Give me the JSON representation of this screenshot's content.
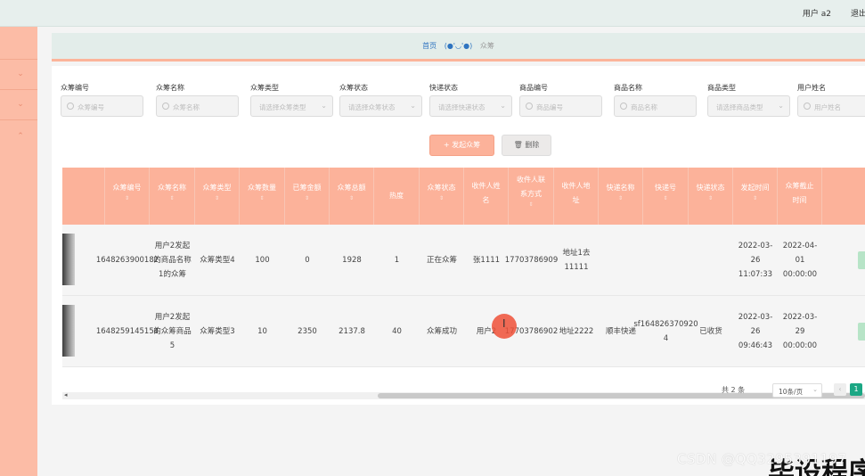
{
  "topbar": {
    "user_label": "用户 a2",
    "logout_label": "退出"
  },
  "breadcrumb": {
    "home": "首页",
    "face": "(●'◡'●)",
    "current": "众筹"
  },
  "filters": [
    {
      "label": "众筹编号",
      "placeholder": "众筹编号",
      "type": "input"
    },
    {
      "label": "众筹名称",
      "placeholder": "众筹名称",
      "type": "input"
    },
    {
      "label": "众筹类型",
      "placeholder": "请选择众筹类型",
      "type": "select"
    },
    {
      "label": "众筹状态",
      "placeholder": "请选择众筹状态",
      "type": "select"
    },
    {
      "label": "快递状态",
      "placeholder": "请选择快递状态",
      "type": "select"
    },
    {
      "label": "商品编号",
      "placeholder": "商品编号",
      "type": "input"
    },
    {
      "label": "商品名称",
      "placeholder": "商品名称",
      "type": "input"
    },
    {
      "label": "商品类型",
      "placeholder": "请选择商品类型",
      "type": "select"
    },
    {
      "label": "用户姓名",
      "placeholder": "用户姓名",
      "type": "input"
    }
  ],
  "buttons": {
    "add": "+ 发起众筹",
    "delete": "🗑 删除"
  },
  "table": {
    "columns": [
      "众筹编号",
      "众筹名称",
      "众筹类型",
      "众筹数量",
      "已筹金额",
      "众筹总额",
      "热度",
      "众筹状态",
      "收件人姓名",
      "收件人联系方式",
      "收件人地址",
      "快递名称",
      "快递号",
      "快递状态",
      "发起时间",
      "众筹截止时间"
    ],
    "rows": [
      [
        "1648263900182",
        "用户2发起的商品名称1的众筹",
        "众筹类型4",
        "100",
        "0",
        "1928",
        "1",
        "正在众筹",
        "张1111",
        "17703786909",
        "地址1去11111",
        "",
        "",
        "",
        "2022-03-26 11:07:33",
        "2022-04-01 00:00:00"
      ],
      [
        "1648259145154",
        "用户2发起的众筹商品5",
        "众筹类型3",
        "10",
        "2350",
        "2137.8",
        "40",
        "众筹成功",
        "用户2",
        "17703786902",
        "地址2222",
        "顺丰快递",
        "sf164826370920 4",
        "已收货",
        "2022-03-26 09:46:43",
        "2022-03-29 00:00:00"
      ]
    ]
  },
  "pagination": {
    "total": "共 2 条",
    "page_size": "10条/页",
    "current_page": "1"
  },
  "watermark": "CSDN @QQ3295391197",
  "overlay_text": "毕设程序",
  "colors": {
    "accent": "#fcb29a",
    "sidebar": "#fcbca6",
    "pager_active": "#1ba784"
  }
}
